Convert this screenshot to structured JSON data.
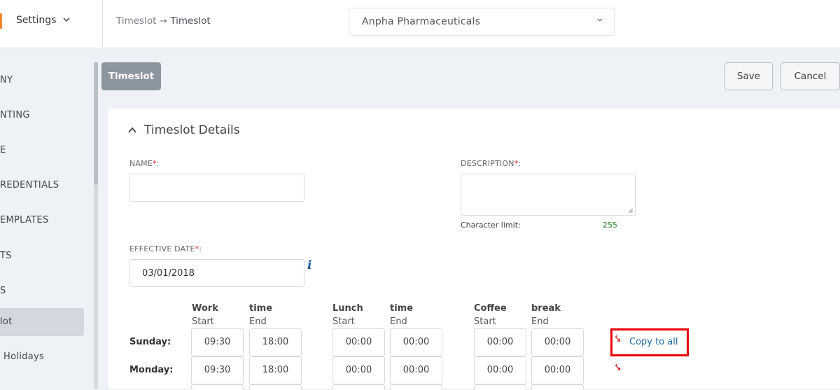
{
  "header": {
    "settings_label": "Settings",
    "breadcrumb_parent": "Timeslot",
    "breadcrumb_arrow": "→",
    "breadcrumb_current": "Timeslot",
    "organization": "Anpha Pharmaceuticals"
  },
  "sidebar": {
    "items": [
      {
        "label": "NY"
      },
      {
        "label": "NTING"
      },
      {
        "label": "E"
      },
      {
        "label": "REDENTIALS"
      },
      {
        "label": "EMPLATES"
      },
      {
        "label": "TS"
      },
      {
        "label": "S"
      },
      {
        "label": "lot"
      },
      {
        "label": "Holidays"
      }
    ]
  },
  "page": {
    "tab_label": "Timeslot",
    "save_label": "Save",
    "cancel_label": "Cancel",
    "section_title": "Timeslot Details"
  },
  "form": {
    "name_label": "NAME",
    "name_value": "",
    "description_label": "DESCRIPTION",
    "description_value": "",
    "char_limit_label": "Character limit:",
    "char_limit_value": "255",
    "effective_date_label": "EFFECTIVE DATE",
    "effective_date_value": "03/01/2018",
    "required_mark": "*",
    "info_icon": "i"
  },
  "schedule": {
    "headers": {
      "work": "Work",
      "work_time": "time",
      "lunch": "Lunch",
      "lunch_time": "time",
      "coffee": "Coffee",
      "coffee_break": "break",
      "start": "Start",
      "end": "End"
    },
    "copy_all_label": "Copy to all",
    "copy_icon": "⤥",
    "rows": [
      {
        "day": "Sunday:",
        "work_start": "09:30",
        "work_end": "18:00",
        "lunch_start": "00:00",
        "lunch_end": "00:00",
        "coffee_start": "00:00",
        "coffee_end": "00:00"
      },
      {
        "day": "Monday:",
        "work_start": "09:30",
        "work_end": "18:00",
        "lunch_start": "00:00",
        "lunch_end": "00:00",
        "coffee_start": "00:00",
        "coffee_end": "00:00"
      }
    ]
  },
  "colors": {
    "accent": "#f0852d",
    "highlight_border": "#e8000b",
    "link": "#1f6aa8",
    "tab_bg": "#8c96a1"
  }
}
